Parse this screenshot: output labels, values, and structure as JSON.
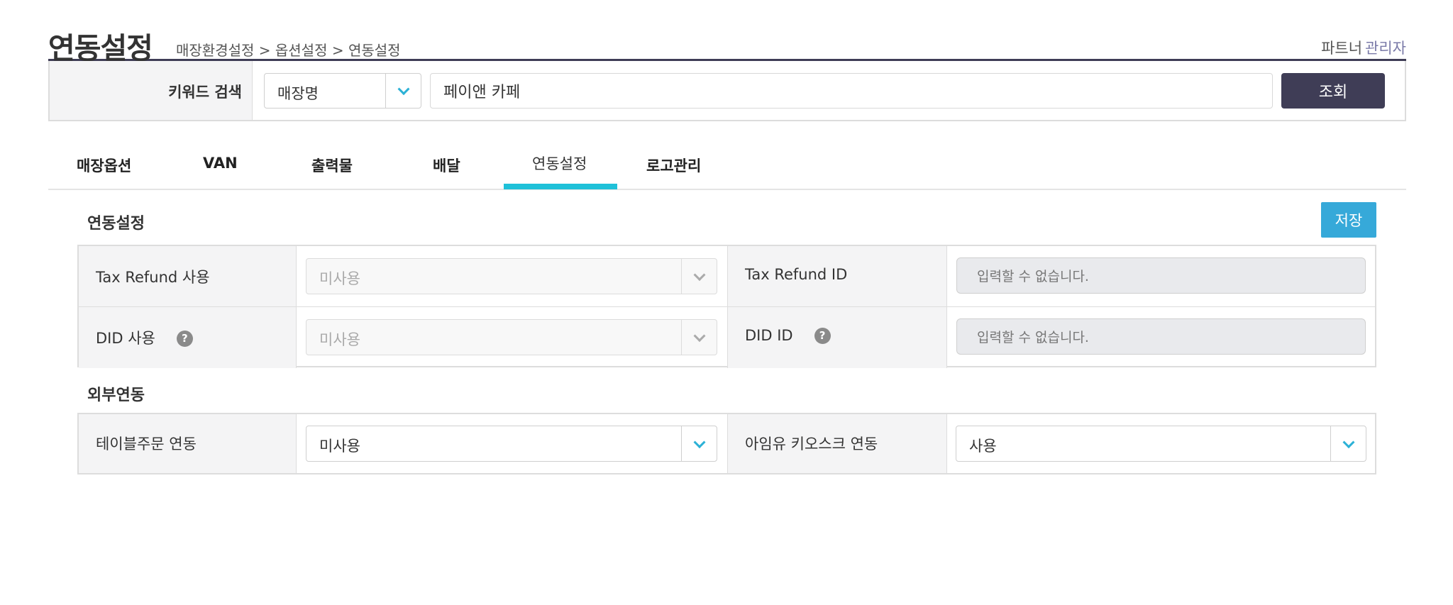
{
  "header": {
    "title": "연동설정",
    "breadcrumb": "매장환경설정 > 옵션설정 > 연동설정",
    "user_role": "파트너",
    "user_name": "관리자"
  },
  "search": {
    "label": "키워드 검색",
    "select_value": "매장명",
    "input_value": "페이앤 카페",
    "button_label": "조회"
  },
  "tabs": [
    {
      "label": "매장옵션",
      "active": false
    },
    {
      "label": "VAN",
      "active": false
    },
    {
      "label": "출력물",
      "active": false
    },
    {
      "label": "배달",
      "active": false
    },
    {
      "label": "연동설정",
      "active": true
    },
    {
      "label": "로고관리",
      "active": false
    }
  ],
  "integration": {
    "section_title": "연동설정",
    "save_label": "저장",
    "rows": [
      {
        "label": "Tax Refund 사용",
        "select_value": "미사용",
        "id_label": "Tax Refund ID",
        "id_placeholder": "입력할 수 없습니다."
      },
      {
        "label": "DID 사용",
        "help": "?",
        "select_value": "미사용",
        "id_label": "DID ID",
        "id_help": "?",
        "id_placeholder": "입력할 수 없습니다."
      }
    ]
  },
  "external": {
    "section_title": "외부연동",
    "table_order_label": "테이블주문 연동",
    "table_order_value": "미사용",
    "kiosk_label": "아임유 키오스크 연동",
    "kiosk_value": "사용"
  },
  "colors": {
    "brand_dark": "#3f3d56",
    "accent": "#2bb1d6",
    "tab_active": "#1fc1d9",
    "save_button": "#36a9d9"
  }
}
